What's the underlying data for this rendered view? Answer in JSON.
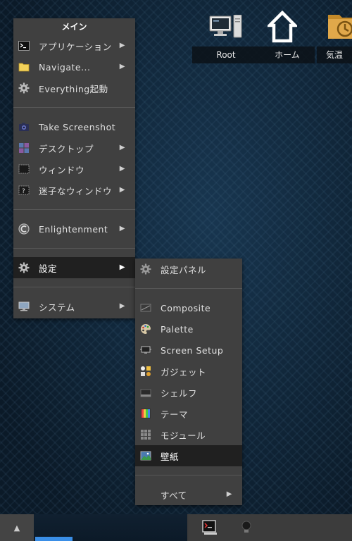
{
  "desktop": {
    "icons": [
      {
        "label": "Root",
        "icon": "computer-icon"
      },
      {
        "label": "ホーム",
        "icon": "home-icon"
      },
      {
        "label": "気温",
        "icon": "clock-folder-icon"
      }
    ]
  },
  "main_menu": {
    "title": "メイン",
    "items": [
      {
        "label": "アプリケーション",
        "icon": "terminal-icon",
        "submenu": true
      },
      {
        "label": "Navigate...",
        "icon": "folder-icon",
        "submenu": true
      },
      {
        "label": "Everything起動",
        "icon": "gear-icon",
        "submenu": false
      },
      {
        "label": "Take Screenshot",
        "icon": "camera-icon",
        "submenu": false
      },
      {
        "label": "デスクトップ",
        "icon": "desktop-icon",
        "submenu": true
      },
      {
        "label": "ウィンドウ",
        "icon": "window-icon",
        "submenu": true
      },
      {
        "label": "迷子なウィンドウ",
        "icon": "lost-window-icon",
        "submenu": true
      },
      {
        "label": "Enlightenment",
        "icon": "enlightenment-icon",
        "submenu": true
      },
      {
        "label": "設定",
        "icon": "gear-icon",
        "submenu": true,
        "active": true
      },
      {
        "label": "システム",
        "icon": "monitor-icon",
        "submenu": true
      }
    ],
    "arrow_glyph": "▶"
  },
  "settings_menu": {
    "items": [
      {
        "label": "設定パネル",
        "icon": "gear-icon"
      },
      {
        "label": "Composite",
        "icon": "composite-icon"
      },
      {
        "label": "Palette",
        "icon": "palette-icon"
      },
      {
        "label": "Screen Setup",
        "icon": "screen-setup-icon"
      },
      {
        "label": "ガジェット",
        "icon": "gadget-icon"
      },
      {
        "label": "シェルフ",
        "icon": "shelf-icon"
      },
      {
        "label": "テーマ",
        "icon": "theme-icon"
      },
      {
        "label": "モジュール",
        "icon": "module-icon"
      },
      {
        "label": "壁紙",
        "icon": "wallpaper-icon",
        "active": true
      },
      {
        "label": "すべて",
        "icon": "",
        "submenu": true
      }
    ]
  },
  "shelf": {
    "up_glyph": "▲"
  },
  "colors": {
    "menu_bg": "#404040",
    "active_bg": "#202020",
    "pager_accent": "#3a8ee6"
  }
}
